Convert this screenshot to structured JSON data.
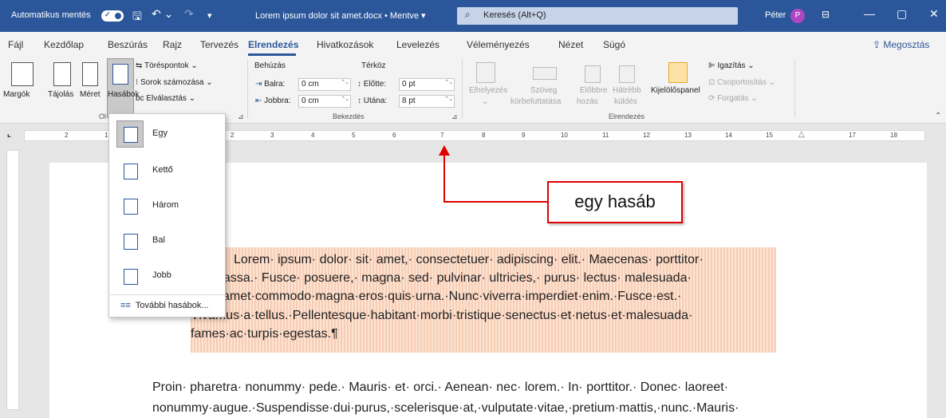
{
  "titlebar": {
    "autosave": "Automatikus mentés",
    "doc_title": "Lorem ipsum dolor sit amet.docx • Mentve ▾",
    "search_placeholder": "Keresés (Alt+Q)",
    "user": "Péter",
    "avatar_letter": "P"
  },
  "tabs": [
    "Fájl",
    "Kezdőlap",
    "Beszúrás",
    "Rajz",
    "Tervezés",
    "Elrendezés",
    "Hivatkozások",
    "Levelezés",
    "Véleményezés",
    "Nézet",
    "Súgó"
  ],
  "active_tab": "Elrendezés",
  "share": "Megosztás",
  "ribbon": {
    "margins": "Margók",
    "orientation": "Tájolás",
    "size": "Méret",
    "columns": "Hasábok",
    "breaks": "Töréspontok",
    "line_numbers": "Sorok számozása",
    "hyphenation": "Elválasztás",
    "group_page_setup": "Ol",
    "indent_title": "Behúzás",
    "spacing_title": "Térköz",
    "left": "Balra:",
    "left_val": "0 cm",
    "right": "Jobbra:",
    "right_val": "0 cm",
    "before": "Előtte:",
    "before_val": "0 pt",
    "after": "Utána:",
    "after_val": "8 pt",
    "group_paragraph": "Bekezdés",
    "position": "Elhelyezés",
    "wrap_text_1": "Szöveg",
    "wrap_text_2": "körbefuttatása",
    "forward_1": "Előbbre",
    "forward_2": "hozás",
    "backward_1": "Hátrébb",
    "backward_2": "küldés",
    "selection_pane": "Kijelölőspanel",
    "align": "Igazítás",
    "group": "Csoportosítás",
    "rotate": "Forgatás",
    "group_arrange": "Elrendezés"
  },
  "ruler_labels": [
    "2",
    "1",
    "2",
    "3",
    "4",
    "5",
    "6",
    "7",
    "8",
    "9",
    "10",
    "11",
    "12",
    "13",
    "14",
    "15",
    "17",
    "18"
  ],
  "columns_menu": {
    "items": [
      "Egy",
      "Kettő",
      "Három",
      "Bal",
      "Jobb"
    ],
    "selected": "Egy",
    "more": "További hasábok..."
  },
  "callout": "egy hasáb",
  "document": {
    "para1_lines": [
      "Lorem· ipsum· dolor· sit· amet,· consectetuer· adipiscing· elit.· Maecenas· porttitor·",
      "ue· massa.· Fusce· posuere,· magna· sed· pulvinar· ultricies,· purus· lectus· malesuada·",
      "o,·sit·amet·commodo·magna·eros·quis·urna.·Nunc·viverra·imperdiet·enim.·Fusce·est.·",
      "Vivamus·a·tellus.·Pellentesque·habitant·morbi·tristique·senectus·et·netus·et·malesuada·",
      "fames·ac·turpis·egestas.¶"
    ],
    "para2_lines": [
      "Proin· pharetra· nonummy· pede.· Mauris· et· orci.· Aenean· nec· lorem.· In· porttitor.· Donec· laoreet·",
      "nonummy·augue.·Suspendisse·dui·purus,·scelerisque·at,·vulputate·vitae,·pretium·mattis,·nunc.·Mauris·"
    ]
  },
  "colors": {
    "accent": "#2b579a",
    "highlight": "#f9cdb3",
    "callout_border": "#e00000"
  }
}
